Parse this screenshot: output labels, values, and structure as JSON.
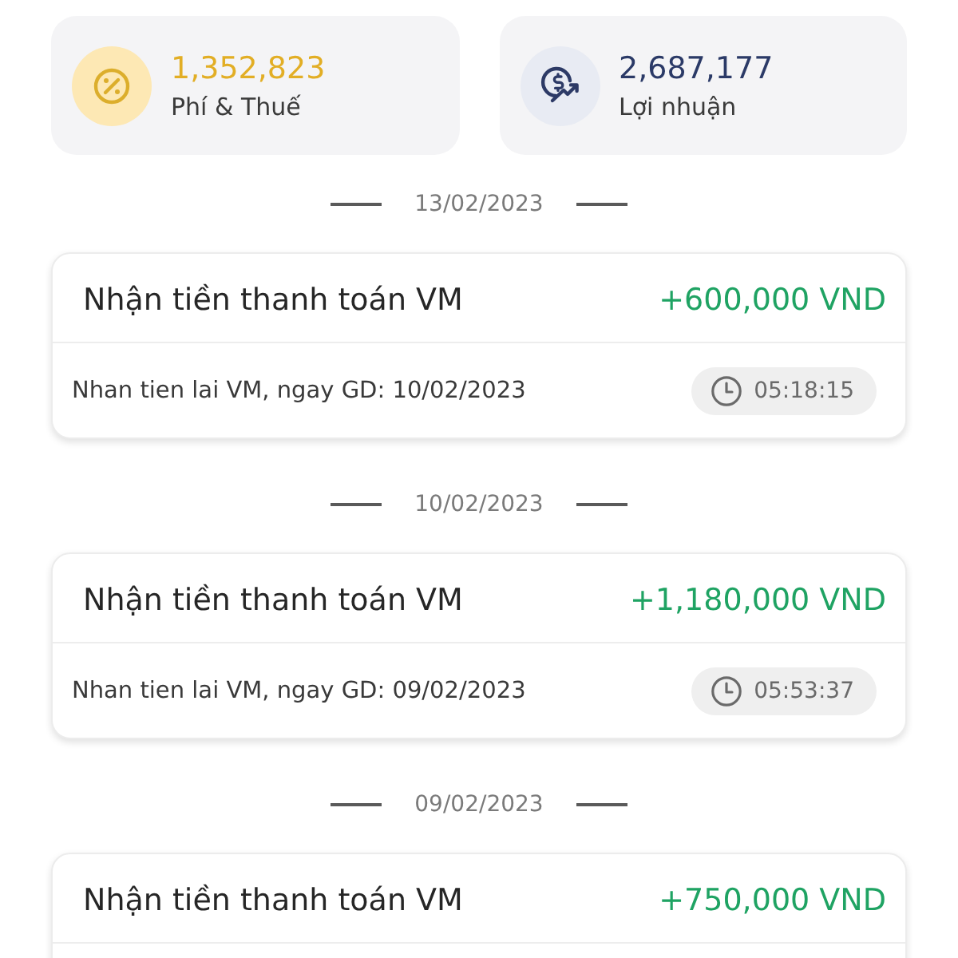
{
  "summary": [
    {
      "kind": "fee",
      "value": "1,352,823",
      "label": "Phí & Thuế"
    },
    {
      "kind": "profit",
      "value": "2,687,177",
      "label": "Lợi nhuận"
    }
  ],
  "groups": [
    {
      "date": "13/02/2023",
      "transactions": [
        {
          "title": "Nhận tiền thanh toán VM",
          "amount": "+600,000 VND",
          "note": "Nhan tien lai VM, ngay GD: 10/02/2023",
          "time": "05:18:15"
        }
      ]
    },
    {
      "date": "10/02/2023",
      "transactions": [
        {
          "title": "Nhận tiền thanh toán VM",
          "amount": "+1,180,000 VND",
          "note": "Nhan tien lai VM, ngay GD: 09/02/2023",
          "time": "05:53:37"
        }
      ]
    },
    {
      "date": "09/02/2023",
      "transactions": [
        {
          "title": "Nhận tiền thanh toán VM",
          "amount": "+750,000 VND"
        }
      ]
    }
  ]
}
